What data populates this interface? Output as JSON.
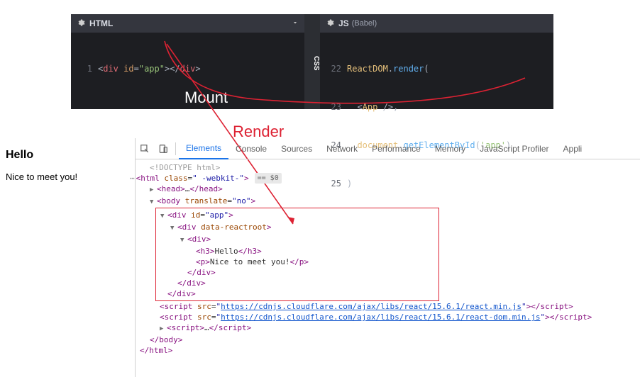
{
  "annotations": {
    "mount": "Mount",
    "render": "Render"
  },
  "editor": {
    "html": {
      "title": "HTML",
      "line1_num": "1",
      "code": "<div id=\"app\"></div>"
    },
    "css_tab": "CSS",
    "js": {
      "title": "JS",
      "subtitle": "(Babel)",
      "lines": [
        {
          "n": "22",
          "t": "ReactDOM.render("
        },
        {
          "n": "23",
          "t": "  <App />,"
        },
        {
          "n": "24",
          "t": "  document.getElementById('app')"
        },
        {
          "n": "25",
          "t": ")"
        }
      ]
    }
  },
  "rendered": {
    "heading": "Hello",
    "paragraph": "Nice to meet you!"
  },
  "devtools": {
    "tabs": [
      "Elements",
      "Console",
      "Sources",
      "Network",
      "Performance",
      "Memory",
      "JavaScript Profiler",
      "Appli"
    ],
    "activeTab": "Elements",
    "doctype": "<!DOCTYPE html>",
    "html_open": "<html class=\" -webkit-\">",
    "eq0": "== $0",
    "head": {
      "open": "<head>",
      "ell": "…",
      "close": "</head>"
    },
    "body_open": "<body translate=\"no\">",
    "app_open": "<div id=\"app\">",
    "reactroot_open": "<div data-reactroot>",
    "inner_div_open": "<div>",
    "h3": {
      "open": "<h3>",
      "text": "Hello",
      "close": "</h3>"
    },
    "p": {
      "open": "<p>",
      "text": "Nice to meet you!",
      "close": "</p>"
    },
    "div_close": "</div>",
    "script1_src": "https://cdnjs.cloudflare.com/ajax/libs/react/15.6.1/react.min.js",
    "script2_src": "https://cdnjs.cloudflare.com/ajax/libs/react/15.6.1/react-dom.min.js",
    "script_open": "<script src=\"",
    "script_mid": "\">",
    "script_close": "</script>",
    "script_plain_open": "<script>",
    "script_plain_ell": "…",
    "script_plain_close": "</script>",
    "body_close": "</body>",
    "html_close": "</html>"
  }
}
